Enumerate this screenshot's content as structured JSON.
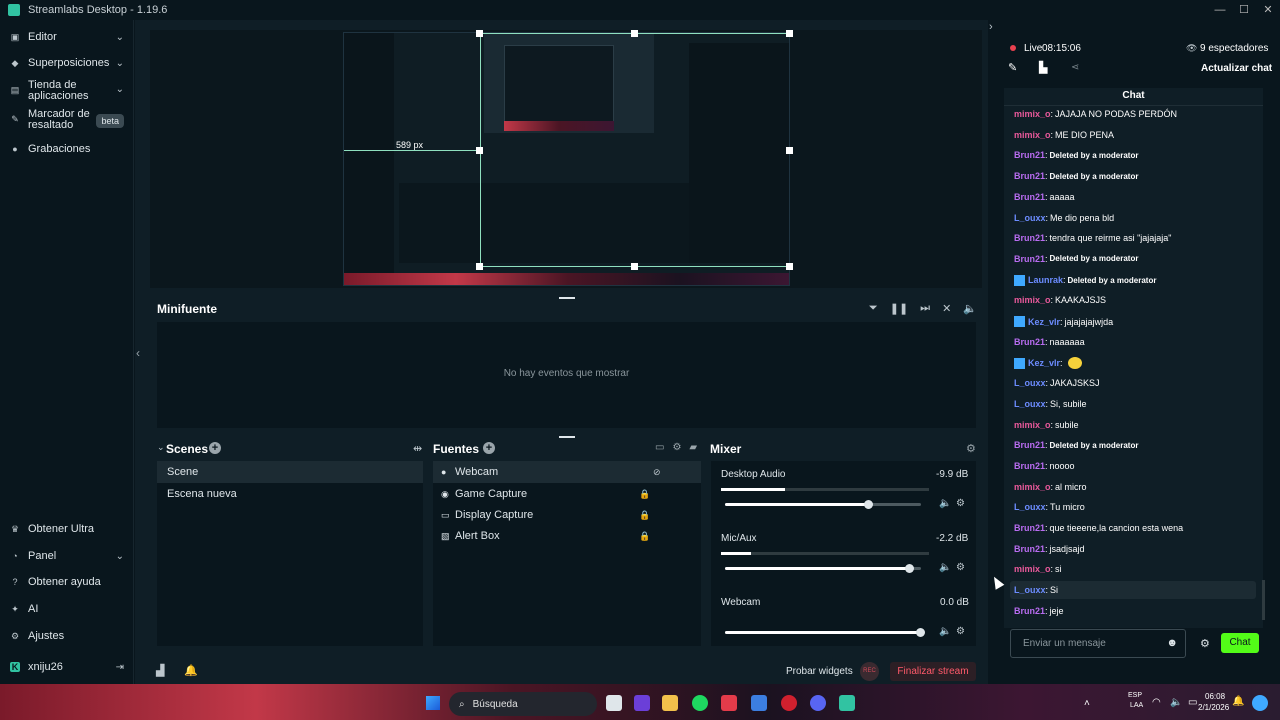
{
  "app": {
    "title": "Streamlabs Desktop - 1.19.6"
  },
  "sidebar": {
    "items": [
      {
        "label": "Editor",
        "icon": "editor-icon"
      },
      {
        "label": "Superposiciones",
        "icon": "overlays-icon"
      },
      {
        "label": "Tienda de aplicaciones",
        "line1": "Tienda de",
        "line2": "aplicaciones",
        "icon": "store-icon"
      },
      {
        "label": "Marcador de resaltado",
        "line1": "Marcador de",
        "line2": "resaltado",
        "badge": "beta",
        "icon": "highlighter-icon"
      },
      {
        "label": "Grabaciones",
        "icon": "recordings-icon"
      }
    ],
    "bottom": [
      {
        "label": "Obtener Ultra"
      },
      {
        "label": "Panel"
      },
      {
        "label": "Obtener ayuda"
      },
      {
        "label": "AI"
      },
      {
        "label": "Ajustes"
      },
      {
        "label": "xniju26"
      }
    ]
  },
  "preview": {
    "size_label": "589 px"
  },
  "minifuente": {
    "title": "Minifuente",
    "empty": "No hay eventos que mostrar"
  },
  "scenes": {
    "title": "Scenes",
    "items": [
      "Scene",
      "Escena nueva"
    ],
    "selected": 0
  },
  "sources": {
    "title": "Fuentes",
    "items": [
      "Webcam",
      "Game Capture",
      "Display Capture",
      "Alert Box"
    ]
  },
  "mixer": {
    "title": "Mixer",
    "channels": [
      {
        "name": "Desktop Audio",
        "db": "-9.9 dB",
        "level": 0.75
      },
      {
        "name": "Mic/Aux",
        "db": "-2.2 dB",
        "level": 0.94
      },
      {
        "name": "Webcam",
        "db": "0.0 dB",
        "level": 1.0
      }
    ]
  },
  "footer": {
    "test_widgets": "Probar widgets",
    "rec": "REC",
    "end_stream": "Finalizar stream"
  },
  "chat": {
    "live_label": "Live",
    "live_time": "08:15:06",
    "viewers": "9 espectadores",
    "refresh": "Actualizar chat",
    "header": "Chat",
    "input_placeholder": "Enviar un mensaje",
    "send_label": "Chat",
    "messages": [
      {
        "user": "mimix_o",
        "color": "#e9599b",
        "text": "JAJAJA NO PODAS PERDÓN"
      },
      {
        "user": "mimix_o",
        "color": "#e9599b",
        "text": "ME DIO PENA"
      },
      {
        "user": "Brun21",
        "color": "#b86cf0",
        "text": "Deleted by a moderator"
      },
      {
        "user": "Brun21",
        "color": "#b86cf0",
        "text": "Deleted by a moderator"
      },
      {
        "user": "Brun21",
        "color": "#b86cf0",
        "text": "aaaaa"
      },
      {
        "user": "L_ouxx",
        "color": "#6c8cff",
        "text": "Me dio pena bld"
      },
      {
        "user": "Brun21",
        "color": "#b86cf0",
        "text": "tendra que reirme asi \"jajajaja\""
      },
      {
        "user": "Brun21",
        "color": "#b86cf0",
        "text": "Deleted by a moderator"
      },
      {
        "user": "Launrak",
        "color": "#6c8cff",
        "text": "Deleted by a moderator"
      },
      {
        "user": "mimix_o",
        "color": "#e9599b",
        "text": "KAAKAJSJS"
      },
      {
        "user": "Kez_vlr",
        "color": "#6c8cff",
        "text": "jajajajajwjda"
      },
      {
        "user": "Brun21",
        "color": "#b86cf0",
        "text": "naaaaaa"
      },
      {
        "user": "Kez_vlr",
        "color": "#6c8cff",
        "text": ""
      },
      {
        "user": "L_ouxx",
        "color": "#6c8cff",
        "text": "JAKAJSKSJ"
      },
      {
        "user": "L_ouxx",
        "color": "#6c8cff",
        "text": "Si, subile"
      },
      {
        "user": "mimix_o",
        "color": "#e9599b",
        "text": "subile"
      },
      {
        "user": "Brun21",
        "color": "#b86cf0",
        "text": "Deleted by a moderator"
      },
      {
        "user": "Brun21",
        "color": "#b86cf0",
        "text": "noooo"
      },
      {
        "user": "mimix_o",
        "color": "#e9599b",
        "text": "al micro"
      },
      {
        "user": "L_ouxx",
        "color": "#6c8cff",
        "text": "Tu micro"
      },
      {
        "user": "Brun21",
        "color": "#b86cf0",
        "text": "que tieeene,la cancion esta wena"
      },
      {
        "user": "Brun21",
        "color": "#b86cf0",
        "text": "jsadjsajd"
      },
      {
        "user": "mimix_o",
        "color": "#e9599b",
        "text": "si"
      },
      {
        "user": "L_ouxx",
        "color": "#6c8cff",
        "text": "Si"
      },
      {
        "user": "Brun21",
        "color": "#b86cf0",
        "text": "jeje"
      }
    ]
  },
  "taskbar": {
    "search": "Búsqueda",
    "lang1": "ESP",
    "lang2": "LAA",
    "time": "06:08",
    "date": "2/1/2026"
  }
}
